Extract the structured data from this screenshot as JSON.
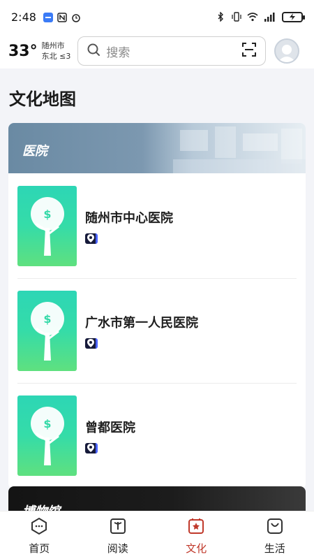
{
  "status_bar": {
    "time": "2:48"
  },
  "header": {
    "temperature": "33°",
    "city": "随州市",
    "wind": "东北 ≤3",
    "search_placeholder": "搜索"
  },
  "page": {
    "title": "文化地图"
  },
  "sections": [
    {
      "label": "医院",
      "items": [
        {
          "name": "随州市中心医院"
        },
        {
          "name": "广水市第一人民医院"
        },
        {
          "name": "曾都医院"
        }
      ]
    },
    {
      "label": "博物馆"
    }
  ],
  "bottom_nav": {
    "items": [
      {
        "label": "首页",
        "icon": "home-icon"
      },
      {
        "label": "阅读",
        "icon": "book-icon"
      },
      {
        "label": "文化",
        "icon": "culture-icon"
      },
      {
        "label": "生活",
        "icon": "bag-icon"
      }
    ],
    "active_color": "#c0392b"
  }
}
